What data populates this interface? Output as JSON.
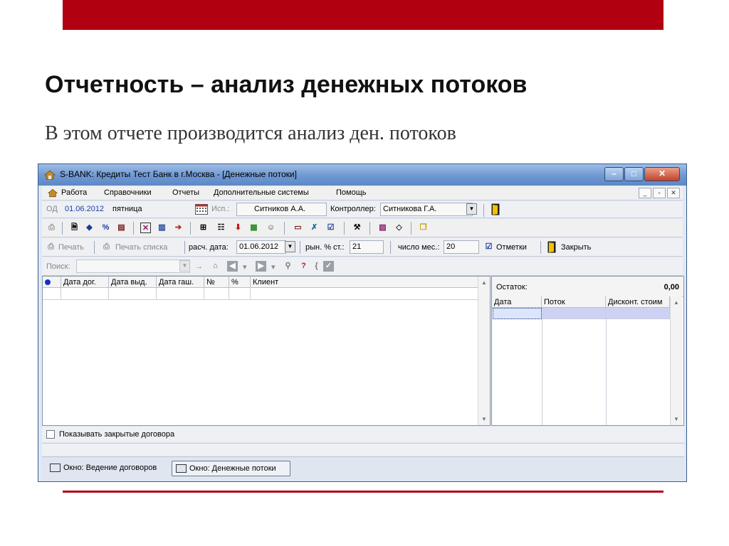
{
  "slide": {
    "title": "Отчетность – анализ денежных потоков",
    "subtitle": "В этом отчете производится анализ ден. потоков",
    "accent_color": "#b1000f"
  },
  "window": {
    "title": "S-BANK: Кредиты Тест Банк в г.Москва - [Денежные потоки]",
    "controls": {
      "minimize": "–",
      "maximize": "□",
      "close": "✕"
    }
  },
  "menu": {
    "items": [
      "Работа",
      "Справочники",
      "Отчеты",
      "Дополнительные системы",
      "Помощь"
    ],
    "mdi": {
      "minimize": "_",
      "restore": "▫",
      "close": "✕"
    }
  },
  "info": {
    "od_label": "ОД",
    "od_date": "01.06.2012",
    "od_day": "пятница",
    "isp_label": "Исп.:",
    "isp_value": "Ситников А.А.",
    "controller_label": "Контроллер:",
    "controller_value": "Ситникова Г.А."
  },
  "actions": {
    "print": "Печать",
    "print_list": "Печать списка",
    "calc_date_label": "расч. дата:",
    "calc_date": "01.06.2012",
    "rate_label": "рын. % ст.:",
    "rate_value": "21",
    "months_label": "число мес.:",
    "months_value": "20",
    "marks": "Отметки",
    "close": "Закрыть"
  },
  "search": {
    "label": "Поиск:",
    "value": ""
  },
  "contracts_grid": {
    "columns": [
      "Дата дог.",
      "Дата выд.",
      "Дата гаш.",
      "№",
      "%",
      "Клиент"
    ]
  },
  "flow_grid": {
    "balance_label": "Остаток:",
    "balance_value": "0,00",
    "columns": [
      "Дата",
      "Поток",
      "Дисконт. стоим"
    ]
  },
  "show_closed": {
    "label": "Показывать закрытые договора",
    "checked": false
  },
  "taskbar": {
    "items": [
      "Окно: Ведение договоров",
      "Окно: Денежные потоки"
    ],
    "active_index": 1
  }
}
